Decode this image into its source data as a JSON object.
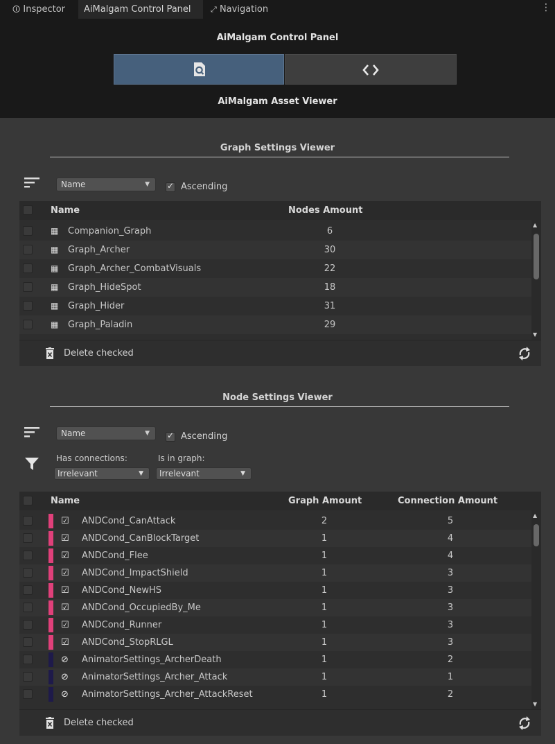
{
  "tabs": [
    {
      "label": "Inspector",
      "icon": "info-icon"
    },
    {
      "label": "AiMalgam Control Panel",
      "icon": ""
    },
    {
      "label": "Navigation",
      "icon": "navigation-icon"
    }
  ],
  "header": {
    "title": "AiMalgam Control Panel",
    "subtitle": "AiMalgam Asset Viewer",
    "segments": [
      {
        "icon": "asset-viewer-icon",
        "selected": true
      },
      {
        "icon": "code-icon",
        "selected": false
      }
    ]
  },
  "graph_viewer": {
    "title": "Graph Settings Viewer",
    "sort_field": "Name",
    "ascending_label": "Ascending",
    "ascending": true,
    "columns": [
      "Name",
      "Nodes Amount"
    ],
    "rows": [
      {
        "name": "Companion_Graph",
        "nodes": "6"
      },
      {
        "name": "Graph_Archer",
        "nodes": "30"
      },
      {
        "name": "Graph_Archer_CombatVisuals",
        "nodes": "22"
      },
      {
        "name": "Graph_HideSpot",
        "nodes": "18"
      },
      {
        "name": "Graph_Hider",
        "nodes": "31"
      },
      {
        "name": "Graph_Paladin",
        "nodes": "29"
      }
    ],
    "delete_label": "Delete checked"
  },
  "node_viewer": {
    "title": "Node Settings Viewer",
    "sort_field": "Name",
    "ascending_label": "Ascending",
    "ascending": true,
    "filter_has_connections_label": "Has connections:",
    "filter_has_connections_value": "Irrelevant",
    "filter_in_graph_label": "Is in graph:",
    "filter_in_graph_value": "Irrelevant",
    "columns": [
      "Name",
      "Graph Amount",
      "Connection Amount"
    ],
    "rows": [
      {
        "name": "ANDCond_CanAttack",
        "graph": "2",
        "conn": "5",
        "color": "#e0407a",
        "icon": "condition-icon"
      },
      {
        "name": "ANDCond_CanBlockTarget",
        "graph": "1",
        "conn": "4",
        "color": "#e0407a",
        "icon": "condition-icon"
      },
      {
        "name": "ANDCond_Flee",
        "graph": "1",
        "conn": "4",
        "color": "#e0407a",
        "icon": "condition-icon"
      },
      {
        "name": "ANDCond_ImpactShield",
        "graph": "1",
        "conn": "3",
        "color": "#e0407a",
        "icon": "condition-icon"
      },
      {
        "name": "ANDCond_NewHS",
        "graph": "1",
        "conn": "3",
        "color": "#e0407a",
        "icon": "condition-icon"
      },
      {
        "name": "ANDCond_OccupiedBy_Me",
        "graph": "1",
        "conn": "3",
        "color": "#e0407a",
        "icon": "condition-icon"
      },
      {
        "name": "ANDCond_Runner",
        "graph": "1",
        "conn": "3",
        "color": "#e0407a",
        "icon": "condition-icon"
      },
      {
        "name": "ANDCond_StopRLGL",
        "graph": "1",
        "conn": "3",
        "color": "#e0407a",
        "icon": "condition-icon"
      },
      {
        "name": "AnimatorSettings_ArcherDeath",
        "graph": "1",
        "conn": "2",
        "color": "#1e1a4a",
        "icon": "animator-icon"
      },
      {
        "name": "AnimatorSettings_Archer_Attack",
        "graph": "1",
        "conn": "1",
        "color": "#1e1a4a",
        "icon": "animator-icon"
      },
      {
        "name": "AnimatorSettings_Archer_AttackReset",
        "graph": "1",
        "conn": "2",
        "color": "#1e1a4a",
        "icon": "animator-icon"
      }
    ],
    "delete_label": "Delete checked"
  },
  "colors": {
    "selected_segment": "#46607c",
    "condition_marker": "#e0407a",
    "animator_marker": "#1e1a4a"
  }
}
